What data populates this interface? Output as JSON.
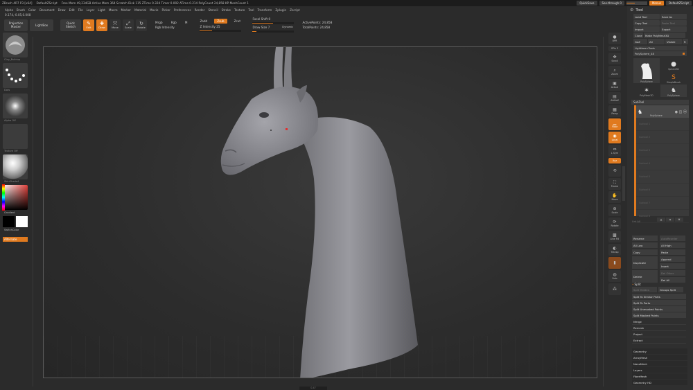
{
  "titlebar": {
    "app": "ZBrush 4R7 P3 [x64]",
    "doc": "DefaultZScript",
    "stats": "Free Mem 49,234GB  Active Mem 364  Scratch Disk 115  ZTime 0.324  Timer 0.002  ATime 0.214  PolyCount 24,858 KP  MeshCount 1",
    "quicksave": "QuickSave",
    "seethrough": "See-through 0",
    "menus": "Menus",
    "script": "DefaultZScript"
  },
  "menubar": [
    "Alpha",
    "Brush",
    "Color",
    "Document",
    "Draw",
    "Edit",
    "File",
    "Layer",
    "Light",
    "Macro",
    "Marker",
    "Material",
    "Movie",
    "Picker",
    "Preferences",
    "Render",
    "Stencil",
    "Stroke",
    "Texture",
    "Tool",
    "Transform",
    "Zplugin",
    "Zscript"
  ],
  "coords": "0.174,-0.05,0.008",
  "shelf": {
    "projection_master": "Projection Master",
    "lightbox": "LightBox",
    "quick_sketch": "Quick Sketch",
    "edit": "Edit",
    "draw": "Draw",
    "move": "Move",
    "scale": "Scale",
    "rotate": "Rotate",
    "mrgb": "Mrgb",
    "rgb": "Rgb",
    "m": "M",
    "rgb_intensity": "Rgb Intensity",
    "zadd": "Zadd",
    "zsub": "Zsub",
    "zcut": "Zcut",
    "z_intensity": "Z Intensity 25",
    "focal_shift": "Focal Shift 0",
    "draw_size": "Draw Size 7",
    "dynamic": "Dynamic",
    "active_points": "ActivePoints: 24,858",
    "total_points": "TotalPoints: 24,858"
  },
  "leftpanel": {
    "brush_label": "Clay_Buildup",
    "stroke_label": "Dots",
    "alpha_label": "Alpha Off",
    "texture_label": "Texture Off",
    "material_label": "SkinShade4",
    "gradient": "Gradient",
    "switch_color": "SwitchColor",
    "alternate": "Alternate"
  },
  "righttools": {
    "bpr": "BPR",
    "spix": "SPix 3",
    "scroll": "Scroll",
    "zoom": "Zoom",
    "actual": "Actual",
    "aahalf": "AAHalf",
    "persp": "Persp",
    "floor": "Floor",
    "local": "Local",
    "lsym": "L.Sym",
    "xyz": "Xyz",
    "frame": "Frame",
    "move": "Move",
    "scale": "Scale",
    "rotate": "Rotate",
    "linefill": "Line Fill",
    "polyf": "PolyF",
    "transp": "Transp",
    "ghost": "Ghost",
    "solo": "Solo",
    "xpose": "Xpose"
  },
  "palette": {
    "title": "Tool",
    "load_tool": "Load Tool",
    "save_as": "Save As",
    "copy_tool": "Copy Tool",
    "paste_tool": "Paste Tool",
    "import": "Import",
    "export": "Export",
    "clone": "Clone",
    "make_polymesh": "Make PolyMesh3D",
    "goz": "GoZ",
    "all": "All",
    "visible": "Visible",
    "r": "R",
    "lightbox_tools": "Lightbox>Tools",
    "polysphere": "PolySphere_48",
    "tools": [
      {
        "name": "PolySphere",
        "icon": "giraffe-icon"
      },
      {
        "name": "Sphere3D",
        "icon": "sphere-icon"
      },
      {
        "name": "SimpleBrush",
        "icon": "brush-s-icon"
      },
      {
        "name": "PolyMesh3D",
        "icon": "star-icon"
      },
      {
        "name": "PolySphere",
        "icon": "giraffe-icon"
      }
    ],
    "subtool_title": "SubTool",
    "subtool_active": "PolySphere",
    "subtool_empty": [
      "Subtool 1",
      "Subtool 2",
      "Subtool 3",
      "Subtool 4",
      "Subtool 5",
      "Subtool 6",
      "Subtool 7",
      "Subtool 8"
    ],
    "list_all": "List All",
    "ops": {
      "rename": "Rename",
      "autoreorder": "AutoReorder",
      "all_low": "All Low",
      "all_high": "All High",
      "copy": "Copy",
      "paste": "Paste",
      "append": "Append",
      "duplicate": "Duplicate",
      "insert": "Insert",
      "del_other": "Del Other",
      "delete": "Delete",
      "del_all": "Del All"
    },
    "split_title": "Split",
    "split_hidden": "Split Hidden",
    "groups_split": "Groups Split",
    "split_similar": "Split To Similar Parts",
    "split_parts": "Split To Parts",
    "split_unmasked": "Split Unmasked Points",
    "split_masked": "Split Masked Points",
    "merge": "Merge",
    "remesh": "Remesh",
    "project": "Project",
    "extract": "Extract",
    "subpalettes": [
      "Geometry",
      "ArrayMesh",
      "NanoMesh",
      "Layers",
      "FiberMesh",
      "Geometry HD"
    ]
  },
  "bottom": "0.47"
}
